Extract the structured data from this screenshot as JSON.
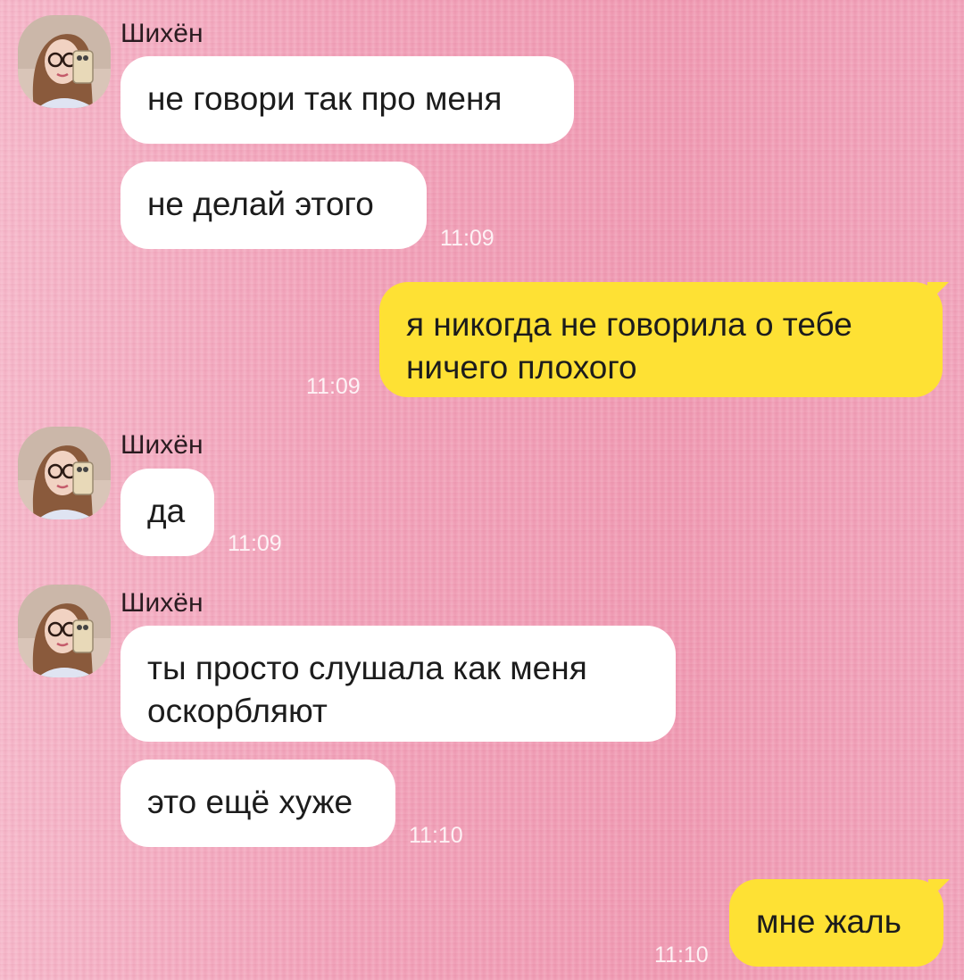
{
  "colors": {
    "incoming_bubble": "#ffffff",
    "outgoing_bubble": "#fee134",
    "background": "#f2a6bd",
    "timestamp": "#fbe7ee"
  },
  "contact": {
    "name": "Шихён",
    "avatar_icon": "contact-avatar-photo"
  },
  "messages": [
    {
      "direction": "in",
      "sender": "Шихён",
      "lines": [
        "не говори так про меня"
      ],
      "time": ""
    },
    {
      "direction": "in",
      "lines": [
        "не делай этого"
      ],
      "time": "11:09"
    },
    {
      "direction": "out",
      "lines": [
        "я никогда не говорила о тебе",
        "ничего плохого"
      ],
      "time": "11:09"
    },
    {
      "direction": "in",
      "sender": "Шихён",
      "lines": [
        "да"
      ],
      "time": "11:09"
    },
    {
      "direction": "in",
      "sender": "Шихён",
      "lines": [
        "ты просто слушала как меня",
        "оскорбляют"
      ],
      "time": ""
    },
    {
      "direction": "in",
      "lines": [
        "это ещё хуже"
      ],
      "time": "11:10"
    },
    {
      "direction": "out",
      "lines": [
        "мне жаль"
      ],
      "time": "11:10"
    }
  ]
}
